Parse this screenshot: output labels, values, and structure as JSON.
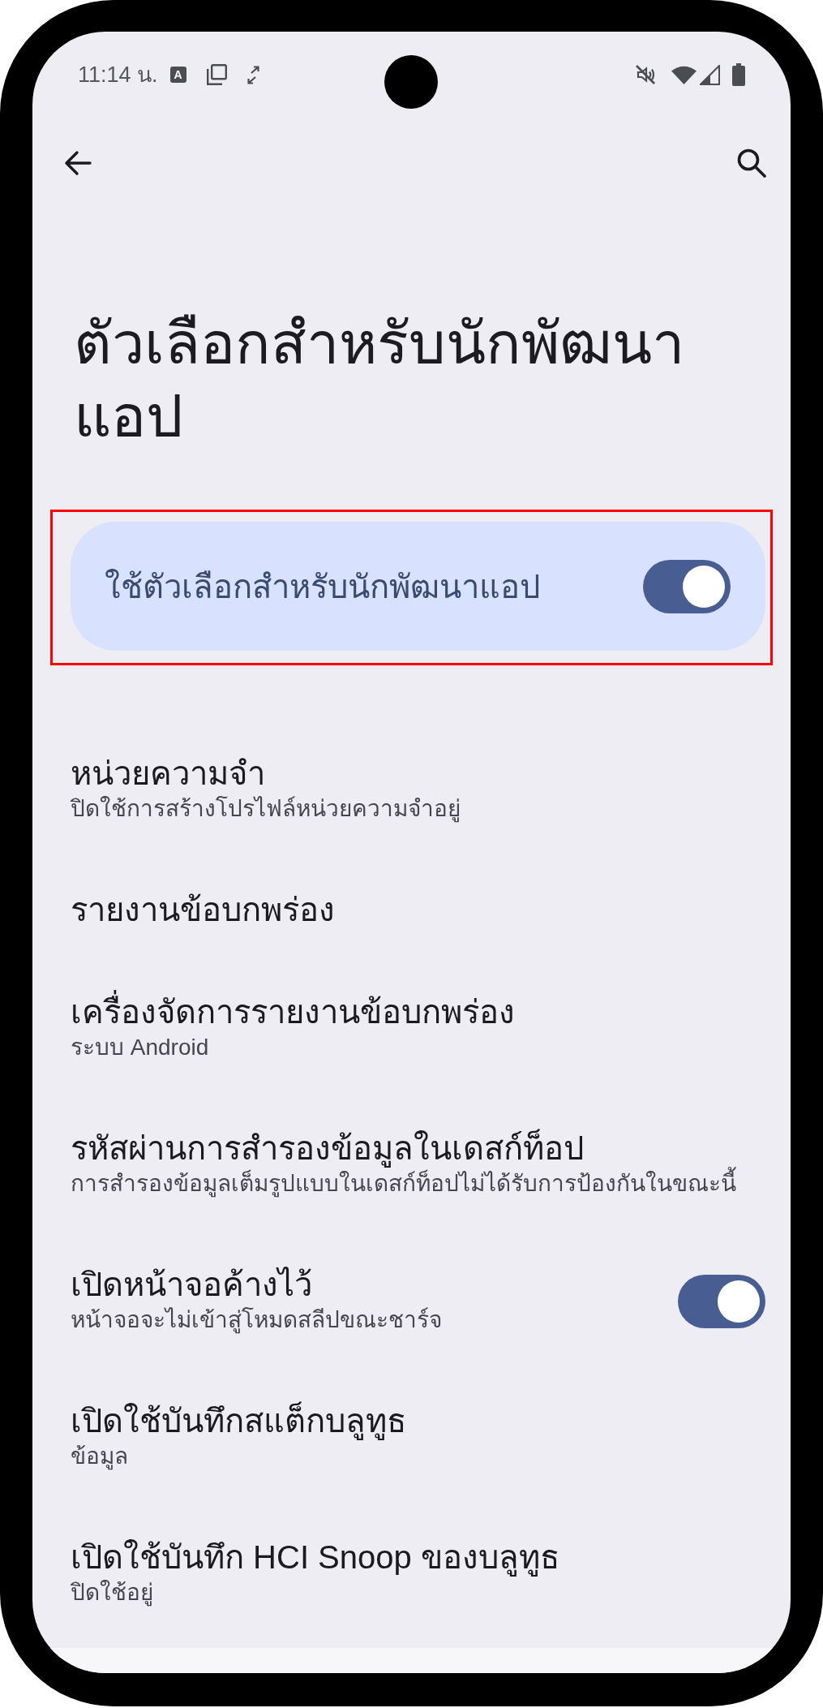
{
  "status_bar": {
    "time": "11:14 น.",
    "badge": "A"
  },
  "title": "ตัวเลือกสำหรับนักพัฒนาแอป",
  "main_switch": {
    "label": "ใช้ตัวเลือกสำหรับนักพัฒนาแอป",
    "on": true,
    "highlighted": true
  },
  "settings": [
    {
      "kind": "text",
      "title": "หน่วยความจำ",
      "summary": "ปิดใช้การสร้างโปรไฟล์หน่วยความจำอยู่"
    },
    {
      "kind": "text",
      "title": "รายงานข้อบกพร่อง"
    },
    {
      "kind": "text",
      "title": "เครื่องจัดการรายงานข้อบกพร่อง",
      "summary": "ระบบ Android"
    },
    {
      "kind": "text",
      "title": "รหัสผ่านการสำรองข้อมูลในเดสก์ท็อป",
      "summary": "การสำรองข้อมูลเต็มรูปแบบในเดสก์ท็อปไม่ได้รับการป้องกันในขณะนี้"
    },
    {
      "kind": "switch",
      "title": "เปิดหน้าจอค้างไว้",
      "summary": "หน้าจอจะไม่เข้าสู่โหมดสลีปขณะชาร์จ",
      "on": true
    },
    {
      "kind": "text",
      "title": "เปิดใช้บันทึกสแต็กบลูทูธ",
      "summary": "ข้อมูล"
    },
    {
      "kind": "text",
      "title": "เปิดใช้บันทึก HCI Snoop ของบลูทูธ",
      "summary": "ปิดใช้อยู่"
    }
  ]
}
